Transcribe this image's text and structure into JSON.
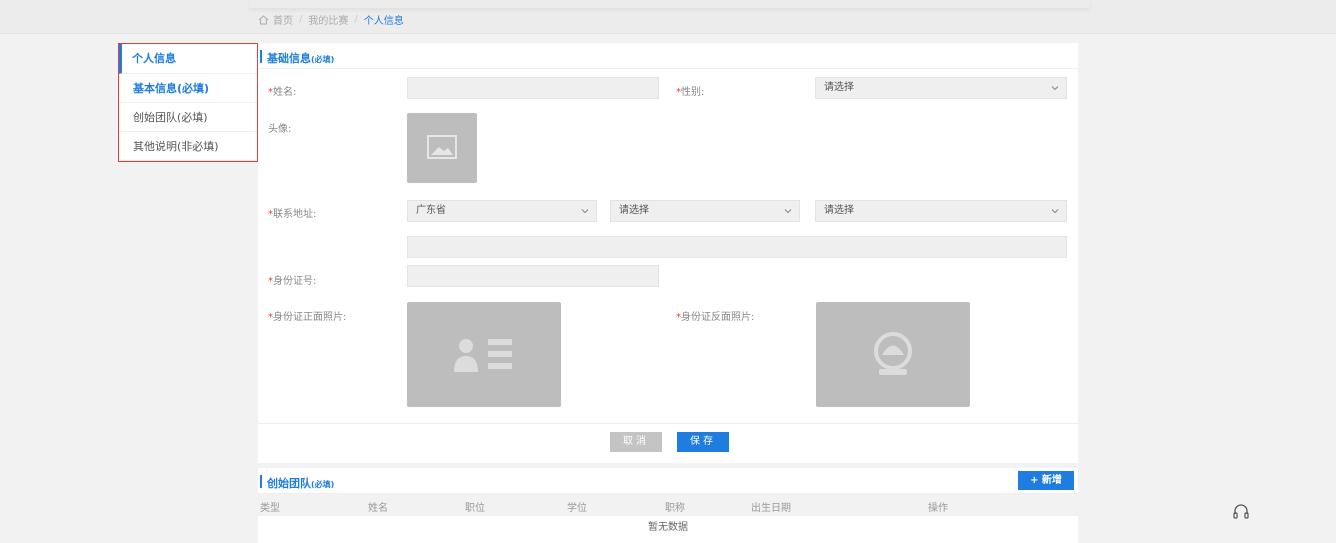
{
  "breadcrumb": {
    "home": "首页",
    "sep": "/",
    "contest": "我的比赛",
    "current": "个人信息"
  },
  "sidebar": {
    "title": "个人信息",
    "items": [
      {
        "label": "基本信息(必填)",
        "active": true
      },
      {
        "label": "创始团队(必填)",
        "active": false
      },
      {
        "label": "其他说明(非必填)",
        "active": false
      }
    ]
  },
  "basic": {
    "title": "基础信息",
    "title_req": "(必填)",
    "name_label": "姓名:",
    "gender_label": "性别:",
    "gender_value": "请选择",
    "avatar_label": "头像:",
    "address_label": "联系地址:",
    "province_value": "广东省",
    "city_value": "请选择",
    "district_value": "请选择",
    "idno_label": "身份证号:",
    "id_front_label": "身份证正面照片:",
    "id_back_label": "身份证反面照片:",
    "required_mark": "*",
    "cancel": "取消",
    "save": "保存"
  },
  "team": {
    "title": "创始团队",
    "title_req": "(必填)",
    "add": "+ 新增",
    "columns": [
      "类型",
      "姓名",
      "职位",
      "学位",
      "职称",
      "出生日期",
      "操作"
    ],
    "empty": "暂无数据"
  },
  "colors": {
    "accent": "#1f7de0",
    "required": "#e83b3b",
    "highlight_border": "#e83b3b"
  },
  "icons": {
    "home": "home-icon",
    "chevron": "chevron-down-icon",
    "image": "image-placeholder-icon",
    "id_front": "id-card-front-icon",
    "id_back": "id-card-back-icon",
    "service": "headset-icon"
  }
}
